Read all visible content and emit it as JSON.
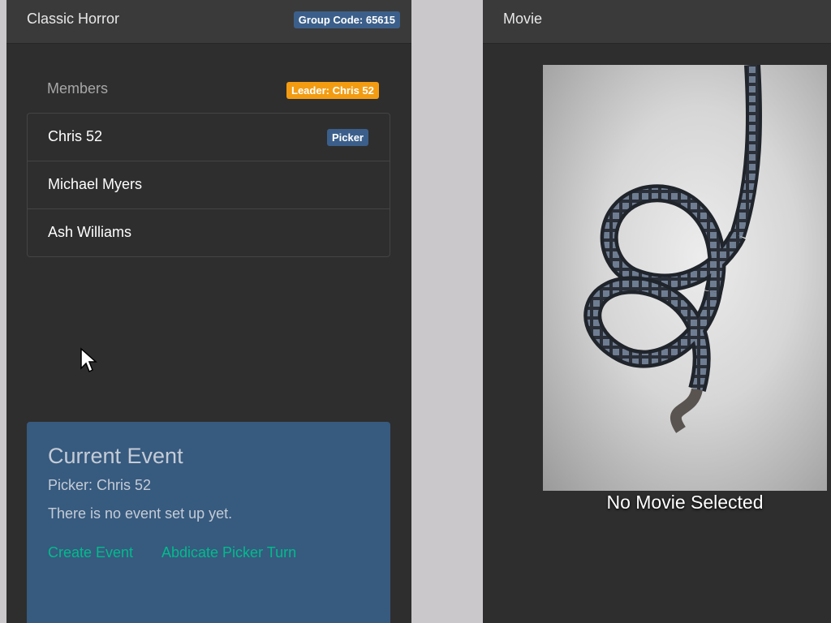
{
  "group": {
    "title": "Classic Horror",
    "code_label": "Group Code: 65615"
  },
  "members": {
    "heading": "Members",
    "leader_label": "Leader: Chris 52",
    "items": [
      {
        "name": "Chris 52",
        "badge": "Picker"
      },
      {
        "name": "Michael Myers"
      },
      {
        "name": "Ash Williams"
      }
    ]
  },
  "event": {
    "title": "Current Event",
    "picker": "Picker: Chris 52",
    "status": "There is no event set up yet.",
    "create_label": "Create Event",
    "abdicate_label": "Abdicate Picker Turn"
  },
  "movie": {
    "title": "Movie",
    "caption": "No Movie Selected"
  },
  "icons": {
    "poster": "film-reel-icon",
    "cursor": "mouse-pointer-icon"
  },
  "colors": {
    "panel_bg": "#2e2e2e",
    "header_bg": "#3a3a3a",
    "primary": "#375a7f",
    "warning": "#f39c12",
    "success_link": "#00bc8c"
  }
}
